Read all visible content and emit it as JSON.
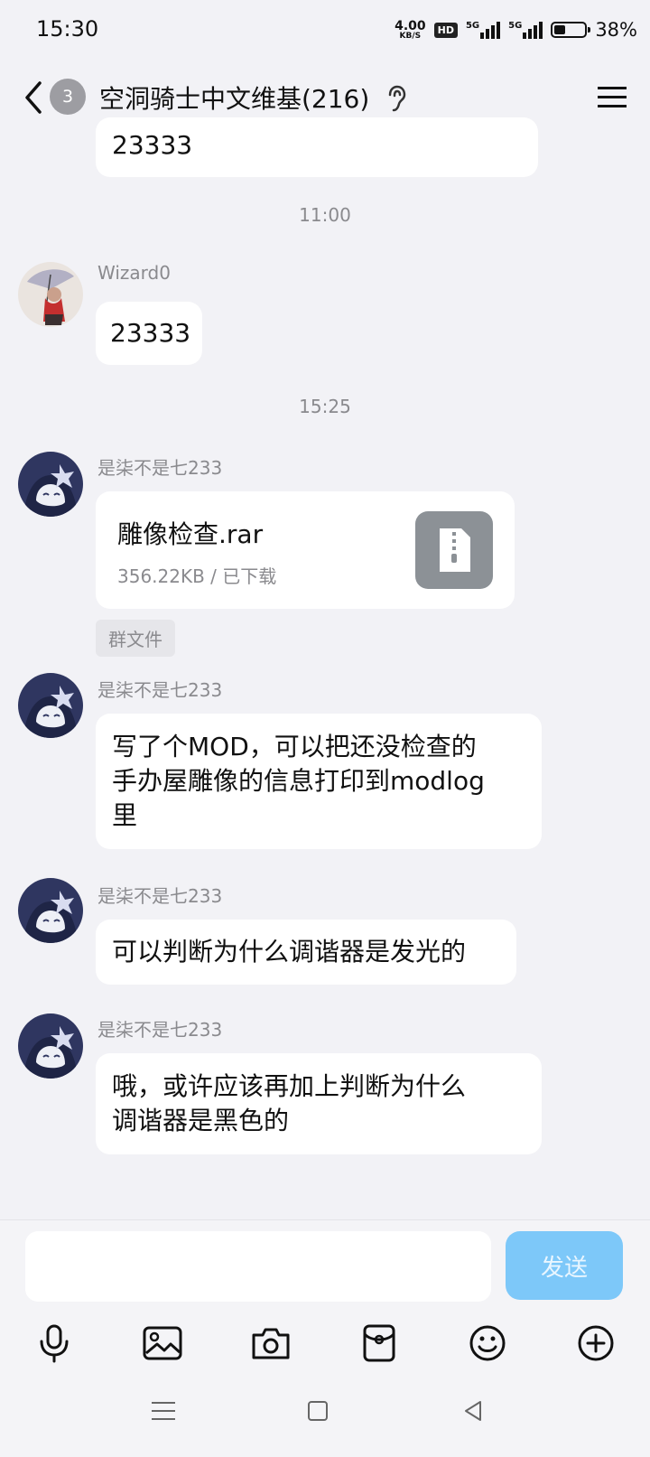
{
  "status_bar": {
    "time": "15:30",
    "net_speed": "4.00",
    "net_speed_unit": "KB/S",
    "hd_label": "HD",
    "sim1_type": "5G",
    "sim2_type": "5G",
    "battery_percent": "38%",
    "battery_level": 0.38
  },
  "header": {
    "unread_count": "3",
    "title": "空洞骑士中文维基(216)",
    "icons": [
      "back-chevron-icon",
      "ear-icon",
      "menu-icon"
    ]
  },
  "messages": {
    "m0": {
      "text": "23333"
    },
    "t1": "11:00",
    "m1": {
      "sender": "Wizard0",
      "text": "23333"
    },
    "t2": "15:25",
    "m2": {
      "sender": "是柒不是七233",
      "file_name": "雕像检查.rar",
      "file_meta": "356.22KB / 已下载",
      "tag": "群文件"
    },
    "m3": {
      "sender": "是柒不是七233",
      "line1": "写了个MOD，可以把还没检查的",
      "line2": "手办屋雕像的信息打印到modlog",
      "line3": "里"
    },
    "m4": {
      "sender": "是柒不是七233",
      "text": "可以判断为什么调谐器是发光的"
    },
    "m5": {
      "sender": "是柒不是七233",
      "line1": "哦，或许应该再加上判断为什么",
      "line2": "调谐器是黑色的"
    }
  },
  "composer": {
    "input_value": "",
    "send_label": "发送",
    "tools": [
      "microphone-icon",
      "image-icon",
      "camera-icon",
      "red-packet-icon",
      "emoji-icon",
      "plus-icon"
    ]
  },
  "colors": {
    "background": "#f2f2f6",
    "bubble": "#ffffff",
    "send_button": "#7dc8f9",
    "badge": "#9d9da2"
  }
}
